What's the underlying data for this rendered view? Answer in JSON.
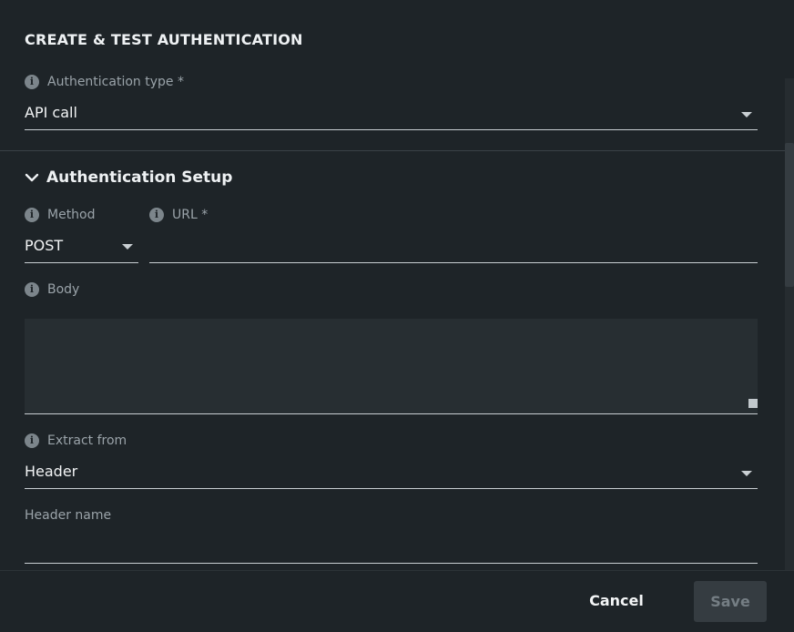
{
  "dialog": {
    "title": "CREATE & TEST AUTHENTICATION"
  },
  "auth_type": {
    "label": "Authentication type *",
    "value": "API call"
  },
  "setup": {
    "title": "Authentication Setup",
    "method": {
      "label": "Method",
      "value": "POST"
    },
    "url": {
      "label": "URL *",
      "value": ""
    },
    "body": {
      "label": "Body",
      "value": ""
    },
    "extract_from": {
      "label": "Extract from",
      "value": "Header"
    },
    "header_name": {
      "label": "Header name",
      "value": ""
    }
  },
  "footer": {
    "cancel_label": "Cancel",
    "save_label": "Save"
  },
  "icons": {
    "info": "info-icon",
    "chevron": "chevron-down-icon",
    "dropdown": "caret-down-icon"
  },
  "colors": {
    "background": "#1e2428",
    "field_background": "#272e32",
    "underline": "#c9cfd3",
    "label": "#9aa3a9",
    "save_disabled": "#353c41"
  }
}
